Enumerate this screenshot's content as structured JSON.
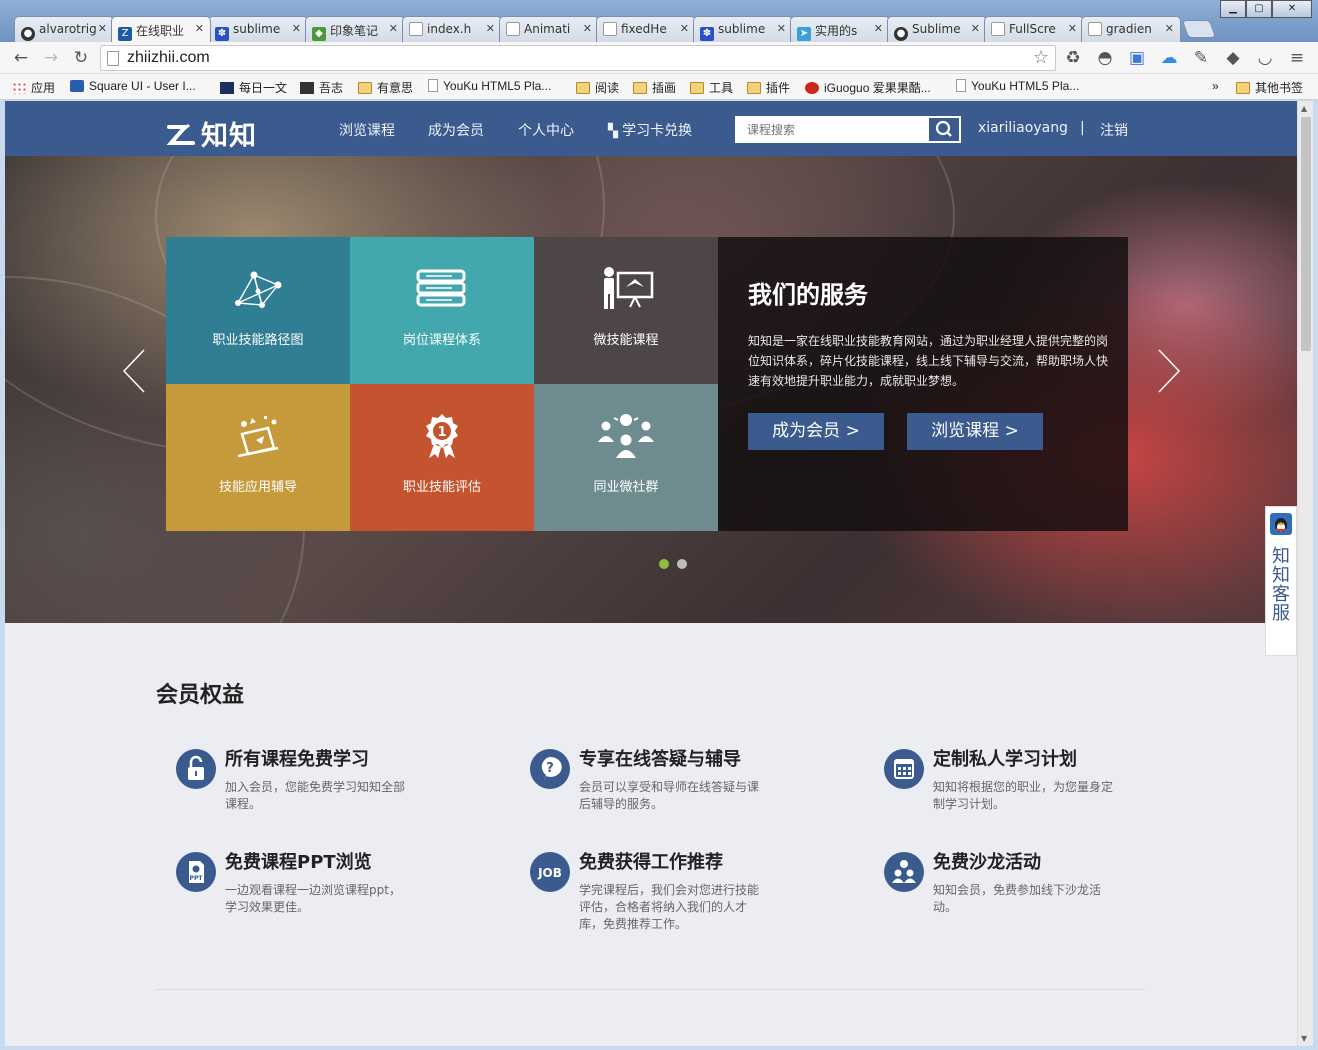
{
  "browser": {
    "tabs": [
      {
        "title": "alvarotrigo",
        "favicon": "github-icon"
      },
      {
        "title": "在线职业",
        "favicon": "zhizhi-icon",
        "active": true
      },
      {
        "title": "sublime",
        "favicon": "baidu-paw-icon"
      },
      {
        "title": "印象笔记",
        "favicon": "evernote-icon"
      },
      {
        "title": "index.h",
        "favicon": "page-icon"
      },
      {
        "title": "Animati",
        "favicon": "page-icon"
      },
      {
        "title": "fixedHe",
        "favicon": "page-icon"
      },
      {
        "title": "sublime",
        "favicon": "baidu-paw-icon"
      },
      {
        "title": "实用的s",
        "favicon": "telegram-icon"
      },
      {
        "title": "Sublime",
        "favicon": "github-icon"
      },
      {
        "title": "FullScre",
        "favicon": "page-icon"
      },
      {
        "title": "gradien",
        "favicon": "page-icon"
      }
    ],
    "address": "zhiizhii.com",
    "bookmarks": [
      {
        "label": "应用",
        "icon": "apps-grid-icon"
      },
      {
        "label": "Square UI - User I...",
        "icon": "square-ui-icon"
      },
      {
        "label": "每日一文",
        "icon": "meiriyiwen-icon"
      },
      {
        "label": "吾志",
        "icon": "wuzhi-icon"
      },
      {
        "label": "有意思",
        "icon": "folder-icon"
      },
      {
        "label": "YouKu HTML5 Pla...",
        "icon": "page-icon"
      },
      {
        "label": "阅读",
        "icon": "folder-icon"
      },
      {
        "label": "插画",
        "icon": "folder-icon"
      },
      {
        "label": "工具",
        "icon": "folder-icon"
      },
      {
        "label": "插件",
        "icon": "folder-icon"
      },
      {
        "label": "iGuoguo 爱果果酷...",
        "icon": "iguoguo-icon"
      },
      {
        "label": "YouKu HTML5 Pla...",
        "icon": "page-icon"
      }
    ],
    "overflow": "»",
    "other_bookmarks": "其他书签"
  },
  "site": {
    "logo": "知知",
    "nav": [
      "浏览课程",
      "成为会员",
      "个人中心",
      "学习卡兑换"
    ],
    "search_placeholder": "课程搜索",
    "username": "xiariliaoyang",
    "separator": "|",
    "logout": "注销"
  },
  "hero": {
    "tiles": [
      {
        "label": "职业技能路径图",
        "color": "#2f7e93",
        "icon": "network-graph-icon"
      },
      {
        "label": "岗位课程体系",
        "color": "#43a8ad",
        "icon": "books-stack-icon"
      },
      {
        "label": "微技能课程",
        "color": "#4e4646",
        "icon": "teacher-board-icon"
      },
      {
        "label": "技能应用辅导",
        "color": "#c59a3a",
        "icon": "laptop-tools-icon"
      },
      {
        "label": "职业技能评估",
        "color": "#c4532f",
        "icon": "award-ribbon-icon"
      },
      {
        "label": "同业微社群",
        "color": "#6e8b8f",
        "icon": "community-icon"
      }
    ],
    "service_title": "我们的服务",
    "service_text": "知知是一家在线职业技能教育网站，通过为职业经理人提供完整的岗位知识体系，碎片化技能课程，线上线下辅导与交流，帮助职场人快速有效地提升职业能力，成就职业梦想。",
    "btn_member": "成为会员  >",
    "btn_browse": "浏览课程  >",
    "active_dot": 0,
    "dot_colors": [
      "#8fbf3a",
      "#bdbdbd"
    ]
  },
  "qq_service": "知知客服",
  "benefits": {
    "title": "会员权益",
    "items": [
      {
        "title": "所有课程免费学习",
        "desc": "加入会员，您能免费学习知知全部课程。",
        "icon": "unlock-icon"
      },
      {
        "title": "专享在线答疑与辅导",
        "desc": "会员可以享受和导师在线答疑与课后辅导的服务。",
        "icon": "question-bubble-icon"
      },
      {
        "title": "定制私人学习计划",
        "desc": "知知将根据您的职业，为您量身定制学习计划。",
        "icon": "calendar-icon"
      },
      {
        "title": "免费课程PPT浏览",
        "desc": "一边观看课程一边浏览课程ppt，学习效果更佳。",
        "icon": "ppt-file-icon"
      },
      {
        "title": "免费获得工作推荐",
        "desc": "学完课程后，我们会对您进行技能评估，合格者将纳入我们的人才库，免费推荐工作。",
        "icon": "job-icon"
      },
      {
        "title": "免费沙龙活动",
        "desc": "知知会员，免费参加线下沙龙活动。",
        "icon": "group-people-icon"
      }
    ]
  },
  "colors": {
    "brand": "#3b5a8e",
    "page_bg": "#ecedf2"
  }
}
